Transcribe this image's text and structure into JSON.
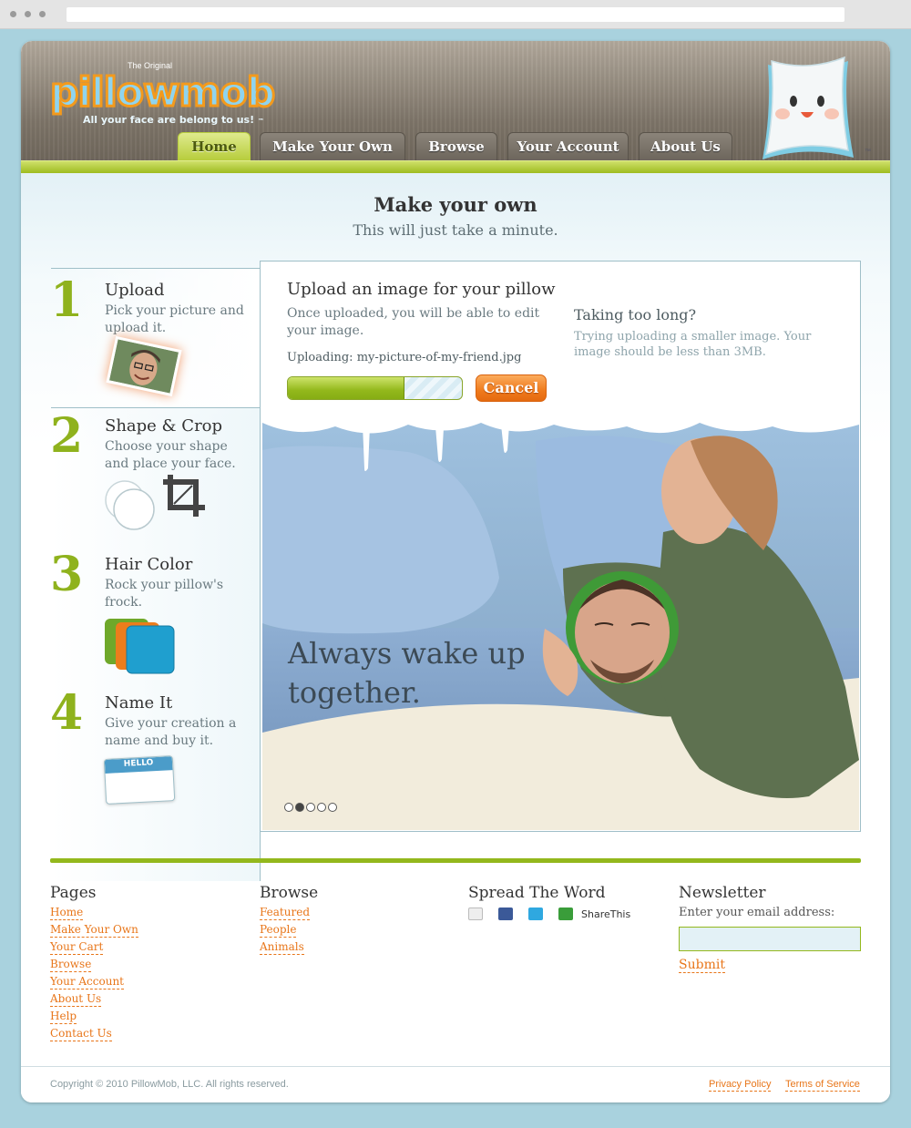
{
  "logo": {
    "original": "The Original",
    "name": "pillowmob",
    "tagline": "All your face are belong to us!",
    "tm": "™"
  },
  "mascot": {
    "tm": "™"
  },
  "nav": {
    "tabs": [
      "Home",
      "Make Your Own",
      "Browse",
      "Your Account",
      "About Us"
    ],
    "active": "Home"
  },
  "page": {
    "title": "Make your own",
    "subtitle": "This will just take a minute."
  },
  "steps": [
    {
      "number": "1",
      "title": "Upload",
      "desc": "Pick your picture and upload it."
    },
    {
      "number": "2",
      "title": "Shape & Crop",
      "desc": "Choose your shape and place your face."
    },
    {
      "number": "3",
      "title": "Hair Color",
      "desc": "Rock your pillow's frock."
    },
    {
      "number": "4",
      "title": "Name It",
      "desc": "Give your creation a name and buy it."
    }
  ],
  "name_tag": {
    "hello": "HELLO"
  },
  "upload": {
    "title": "Upload an image for your pillow",
    "desc": "Once uploaded, you will be able to edit your image.",
    "file_label": "Uploading: my-picture-of-my-friend.jpg",
    "progress": 0.67,
    "cancel": "Cancel",
    "slow_title": "Taking too long?",
    "slow_desc": "Trying uploading a smaller image. Your image should be less than 3MB."
  },
  "slideshow": {
    "caption": "Always wake up together.",
    "dots": 5,
    "active_dot": 2
  },
  "footer": {
    "pages": {
      "heading": "Pages",
      "links": [
        "Home",
        "Make Your Own",
        "Your Cart",
        "Browse",
        "Your Account",
        "About Us",
        "Help",
        "Contact Us"
      ]
    },
    "browse": {
      "heading": "Browse",
      "links": [
        "Featured",
        "People",
        "Animals"
      ]
    },
    "spread": {
      "heading": "Spread The Word",
      "sharethis": "ShareThis",
      "icons": [
        "email-icon",
        "facebook-icon",
        "twitter-icon",
        "sharethis-icon"
      ]
    },
    "newsletter": {
      "heading": "Newsletter",
      "label": "Enter your email address:",
      "placeholder": "",
      "submit": "Submit"
    }
  },
  "bottom": {
    "copyright": "Copyright © 2010 PillowMob, LLC. All rights reserved.",
    "privacy": "Privacy Policy",
    "terms": "Terms of Service"
  },
  "colors": {
    "green": "#93b81c",
    "orange": "#e8761a",
    "sky": "#a9d2de"
  }
}
